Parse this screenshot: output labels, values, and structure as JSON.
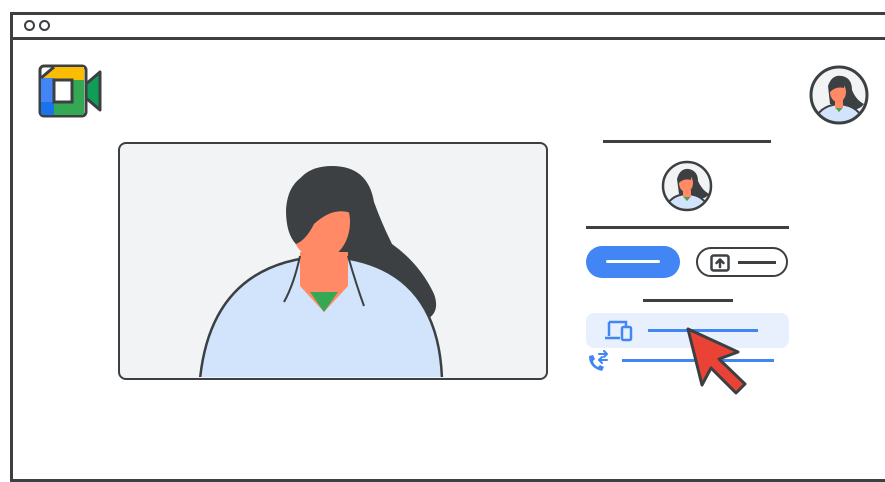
{
  "window": {
    "title": "",
    "controls": [
      "window-dot-icon",
      "window-dot-icon"
    ]
  },
  "app": {
    "logo_icon": "google-meet-logo-icon"
  },
  "header": {
    "account_avatar_icon": "user-avatar-icon"
  },
  "video": {
    "participant_icon": "woman-participant-illustration"
  },
  "side_panel": {
    "avatar_icon": "user-avatar-icon",
    "join_label": "",
    "present_label": "",
    "present_icon": "upload-arrow-icon",
    "options": [
      {
        "icon": "devices-icon",
        "label": "",
        "selected": true
      },
      {
        "icon": "phone-transfer-icon",
        "label": "",
        "selected": false
      }
    ]
  },
  "cursor": {
    "icon": "mouse-pointer-icon"
  },
  "colors": {
    "outline": "#3c4043",
    "accent_blue": "#4285f4",
    "selected_bg": "#e8f0fe",
    "cursor_red": "#ea4335",
    "skin": "#ff8a65",
    "shirt": "#d2e3fc",
    "collar": "#34a853"
  }
}
